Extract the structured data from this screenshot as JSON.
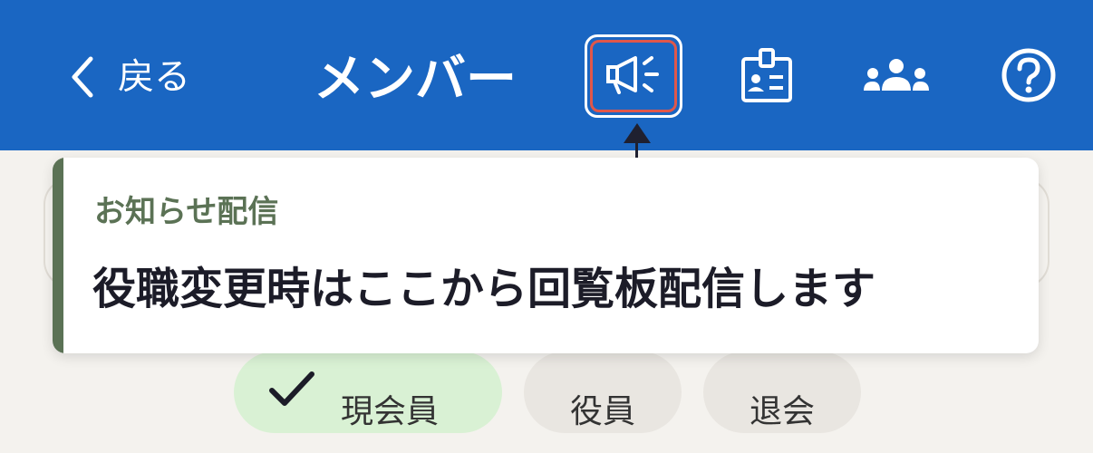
{
  "header": {
    "back_label": "戻る",
    "title": "メンバー",
    "icons": [
      "chevron-left-icon",
      "megaphone-icon",
      "id-badge-icon",
      "group-icon",
      "help-icon"
    ]
  },
  "filter_chips": [
    {
      "label": "現会員",
      "selected": true
    },
    {
      "label": "役員",
      "selected": false
    },
    {
      "label": "退会",
      "selected": false
    }
  ],
  "tooltip": {
    "heading": "お知らせ配信",
    "body": "役職変更時はここから回覧板配信します"
  },
  "colors": {
    "header_bg": "#1a66c2",
    "highlight_border": "#e0574a",
    "tooltip_accent": "#5b7255",
    "page_bg": "#f4f2ee",
    "chip_selected_bg": "#d9f1d4"
  }
}
